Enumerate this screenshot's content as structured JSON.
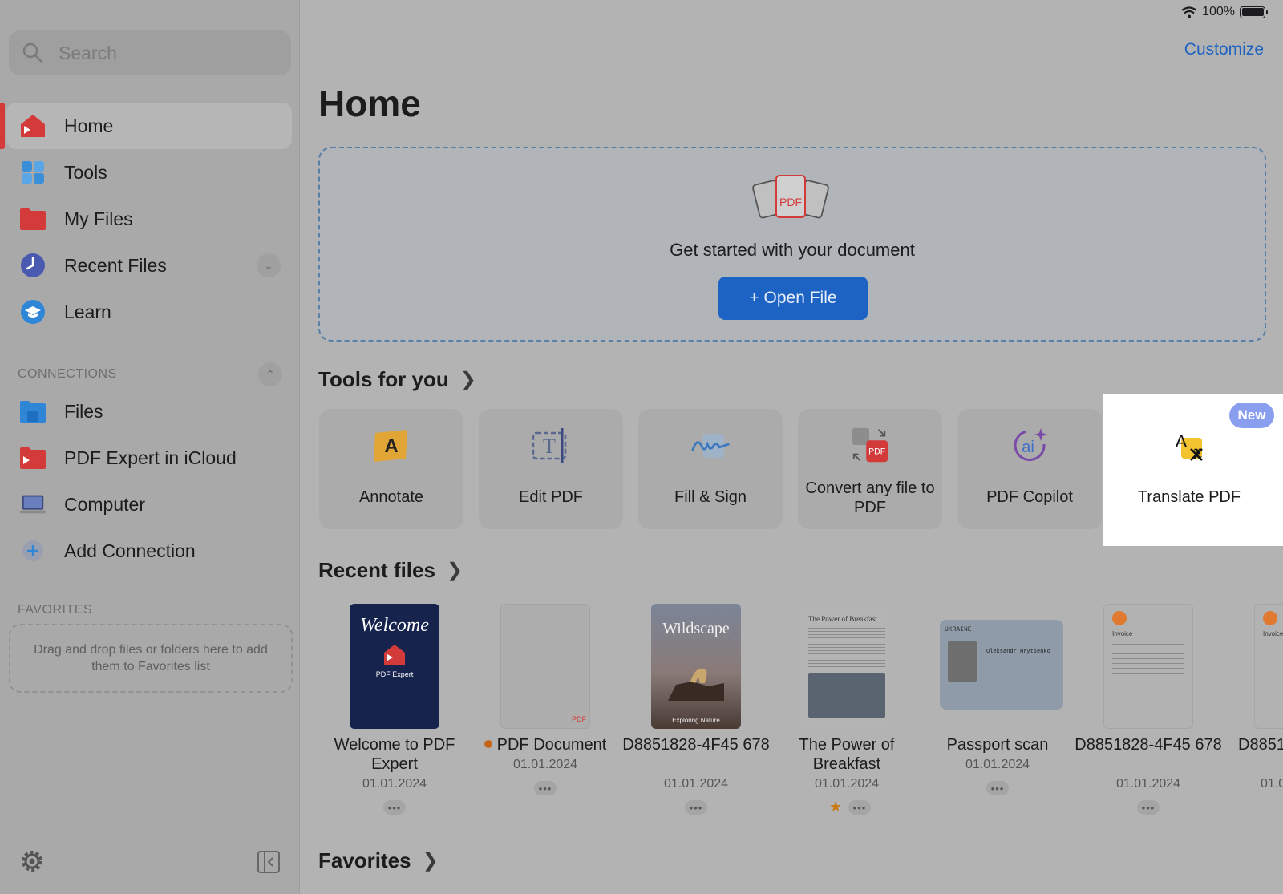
{
  "status_bar": {
    "battery": "100%"
  },
  "sidebar": {
    "search_placeholder": "Search",
    "nav": [
      {
        "label": "Home",
        "icon": "home-icon",
        "active": true
      },
      {
        "label": "Tools",
        "icon": "tools-grid-icon"
      },
      {
        "label": "My Files",
        "icon": "folder-icon"
      },
      {
        "label": "Recent Files",
        "icon": "clock-icon"
      },
      {
        "label": "Learn",
        "icon": "graduation-cap-icon"
      }
    ],
    "connections_label": "CONNECTIONS",
    "connections": [
      {
        "label": "Files",
        "icon": "files-folder-icon"
      },
      {
        "label": "PDF Expert in iCloud",
        "icon": "icloud-folder-icon"
      },
      {
        "label": "Computer",
        "icon": "laptop-icon"
      },
      {
        "label": "Add Connection",
        "icon": "plus-icon"
      }
    ],
    "favorites_label": "FAVORITES",
    "favorites_hint": "Drag and drop files or folders here to add them to Favorites list"
  },
  "header": {
    "customize": "Customize",
    "title": "Home"
  },
  "dropzone": {
    "text": "Get started with your document",
    "button": "+ Open File"
  },
  "tools_section": {
    "title": "Tools for you",
    "items": [
      {
        "label": "Annotate",
        "icon": "annotate-icon"
      },
      {
        "label": "Edit PDF",
        "icon": "edit-text-icon"
      },
      {
        "label": "Fill & Sign",
        "icon": "signature-icon"
      },
      {
        "label": "Convert any file to PDF",
        "icon": "convert-icon"
      },
      {
        "label": "PDF Copilot",
        "icon": "ai-icon"
      },
      {
        "label": "Translate PDF",
        "icon": "translate-icon",
        "badge": "New"
      }
    ]
  },
  "recent_section": {
    "title": "Recent files",
    "files": [
      {
        "name": "Welcome to PDF Expert",
        "date": "01.01.2024",
        "thumb_title": "Welcome",
        "thumb_sub": "PDF Expert"
      },
      {
        "name": "PDF Document",
        "date": "01.01.2024",
        "thumb_tag": "PDF"
      },
      {
        "name": "D8851828-4F45 678",
        "date": "01.01.2024",
        "thumb_title": "Wildscape",
        "thumb_sub": "Exploring Nature"
      },
      {
        "name": "The Power of Breakfast",
        "date": "01.01.2024",
        "thumb_title": "The Power of Breakfast",
        "starred": true
      },
      {
        "name": "Passport scan",
        "date": "01.01.2024",
        "thumb_title": "UKRAINE",
        "thumb_sub": "Oleksandr Hrytsenko"
      },
      {
        "name": "D8851828-4F45 678",
        "date": "01.01.2024",
        "thumb_title": "Invoice"
      },
      {
        "name": "D8851",
        "date": "01.0",
        "thumb_title": "Invoice"
      }
    ]
  },
  "favorites_section": {
    "title": "Favorites"
  }
}
